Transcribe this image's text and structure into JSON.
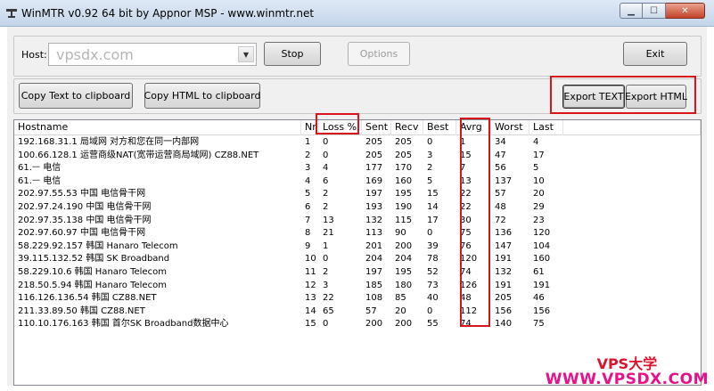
{
  "window": {
    "title": "WinMTR v0.92 64 bit by Appnor MSP - www.winmtr.net",
    "icons": {
      "app": "network-icon",
      "minimize": "minimize-icon",
      "maximize": "maximize-icon",
      "close": "close-icon"
    }
  },
  "host": {
    "label": "Host:",
    "value": "vpsdx.com"
  },
  "buttons": {
    "stop": "Stop",
    "options": "Options",
    "exit": "Exit",
    "copy_text": "Copy Text to clipboard",
    "copy_html": "Copy HTML to clipboard",
    "export_text": "Export TEXT",
    "export_html": "Export HTML"
  },
  "table": {
    "columns": [
      "Hostname",
      "Nr",
      "Loss %",
      "Sent",
      "Recv",
      "Best",
      "Avrg",
      "Worst",
      "Last",
      ""
    ],
    "rows": [
      [
        "192.168.31.1 局域网 对方和您在同一内部网",
        "1",
        "0",
        "205",
        "205",
        "0",
        "1",
        "34",
        "4"
      ],
      [
        "100.66.128.1 运营商级NAT(宽带运营商局域网)  CZ88.NET",
        "2",
        "0",
        "205",
        "205",
        "3",
        "15",
        "47",
        "17"
      ],
      [
        "61.ᅳ    电信",
        "3",
        "4",
        "177",
        "170",
        "2",
        "7",
        "56",
        "5"
      ],
      [
        "61.ᅳ   电信",
        "4",
        "6",
        "169",
        "160",
        "5",
        "13",
        "137",
        "10"
      ],
      [
        "202.97.55.53 中国 电信骨干网",
        "5",
        "2",
        "197",
        "195",
        "15",
        "22",
        "57",
        "20"
      ],
      [
        "202.97.24.190 中国 电信骨干网",
        "6",
        "2",
        "193",
        "190",
        "14",
        "22",
        "48",
        "29"
      ],
      [
        "202.97.35.138 中国 电信骨干网",
        "7",
        "13",
        "132",
        "115",
        "17",
        "30",
        "72",
        "23"
      ],
      [
        "202.97.60.97 中国 电信骨干网",
        "8",
        "21",
        "113",
        "90",
        "0",
        "75",
        "136",
        "120"
      ],
      [
        "58.229.92.157 韩国 Hanaro Telecom",
        "9",
        "1",
        "201",
        "200",
        "39",
        "76",
        "147",
        "104"
      ],
      [
        "39.115.132.52 韩国 SK Broadband",
        "10",
        "0",
        "204",
        "204",
        "78",
        "120",
        "191",
        "160"
      ],
      [
        "58.229.10.6 韩国 Hanaro Telecom",
        "11",
        "2",
        "197",
        "195",
        "52",
        "74",
        "132",
        "61"
      ],
      [
        "218.50.5.94 韩国 Hanaro Telecom",
        "12",
        "3",
        "185",
        "180",
        "73",
        "126",
        "191",
        "191"
      ],
      [
        "116.126.136.54 韩国  CZ88.NET",
        "13",
        "22",
        "108",
        "85",
        "40",
        "48",
        "205",
        "46"
      ],
      [
        "211.33.89.50 韩国  CZ88.NET",
        "14",
        "65",
        "57",
        "20",
        "0",
        "112",
        "156",
        "156"
      ],
      [
        "110.10.176.163 韩国 首尔SK Broadband数据中心",
        "15",
        "0",
        "200",
        "200",
        "55",
        "74",
        "140",
        "75"
      ]
    ]
  },
  "watermark": {
    "line1": "VPS大学",
    "line2": "WWW.VPSDX.COM"
  },
  "colors": {
    "highlight": "#d9141b",
    "watermark": "#e8118a"
  }
}
